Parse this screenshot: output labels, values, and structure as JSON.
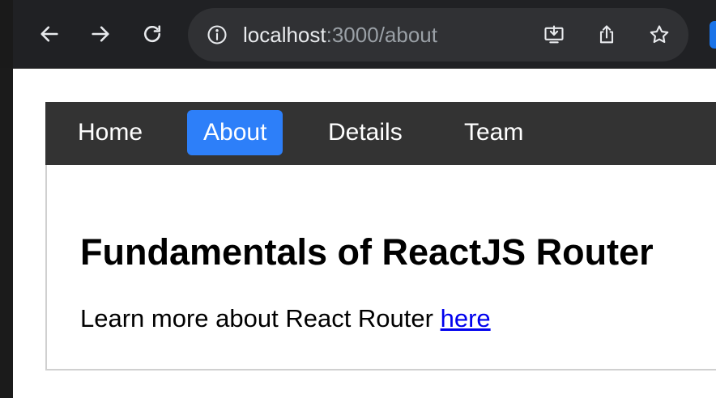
{
  "browser": {
    "url_host": "localhost",
    "url_path": ":3000/about",
    "accent_color": "#1a73e8"
  },
  "nav": {
    "items": [
      {
        "label": "Home",
        "active": false
      },
      {
        "label": "About",
        "active": true
      },
      {
        "label": "Details",
        "active": false
      },
      {
        "label": "Team",
        "active": false
      }
    ],
    "background": "#333333",
    "active_color": "#2d7ff9"
  },
  "content": {
    "title": "Fundamentals of ReactJS Router",
    "text": "Learn more about React Router ",
    "link_label": "here"
  }
}
